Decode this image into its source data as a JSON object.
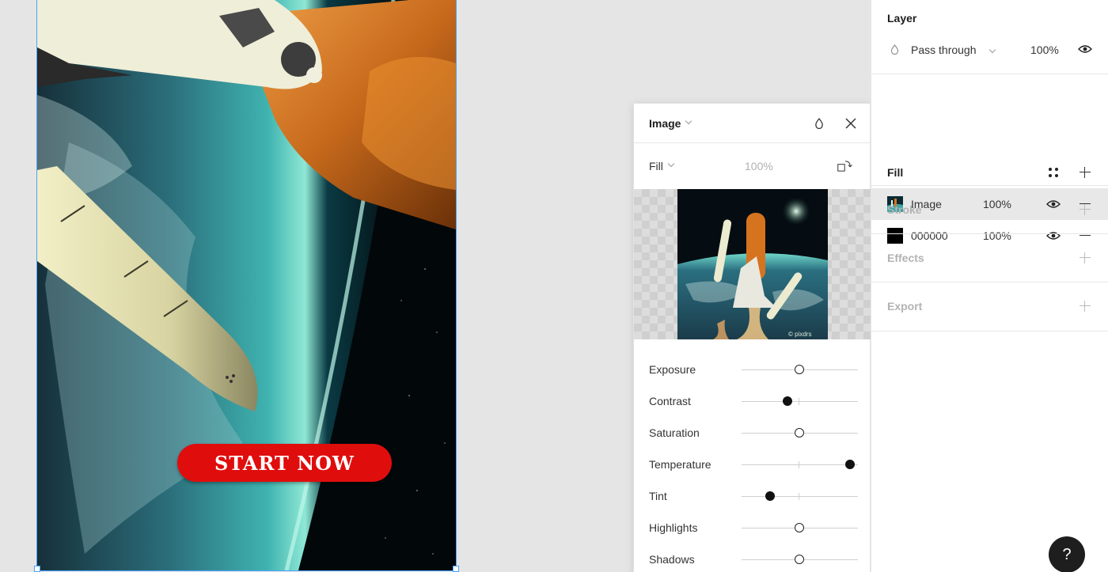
{
  "canvas": {
    "cta_label": "START NOW"
  },
  "popover": {
    "title": "Image",
    "fill_mode": "Fill",
    "fill_opacity": "100%",
    "watermark": "© pixdrs",
    "adjustments": [
      {
        "label": "Exposure",
        "value": 0
      },
      {
        "label": "Contrast",
        "value": -0.21
      },
      {
        "label": "Saturation",
        "value": 0
      },
      {
        "label": "Temperature",
        "value": 0.87
      },
      {
        "label": "Tint",
        "value": -0.51
      },
      {
        "label": "Highlights",
        "value": 0
      },
      {
        "label": "Shadows",
        "value": 0
      }
    ]
  },
  "panel": {
    "layer": {
      "title": "Layer",
      "blend_mode": "Pass through",
      "opacity": "100%"
    },
    "fill": {
      "title": "Fill",
      "items": [
        {
          "name": "Image",
          "opacity": "100%"
        },
        {
          "name": "000000",
          "opacity": "100%"
        }
      ]
    },
    "stroke": {
      "title": "Stroke"
    },
    "effects": {
      "title": "Effects"
    },
    "export": {
      "title": "Export"
    }
  },
  "help": {
    "label": "?"
  }
}
